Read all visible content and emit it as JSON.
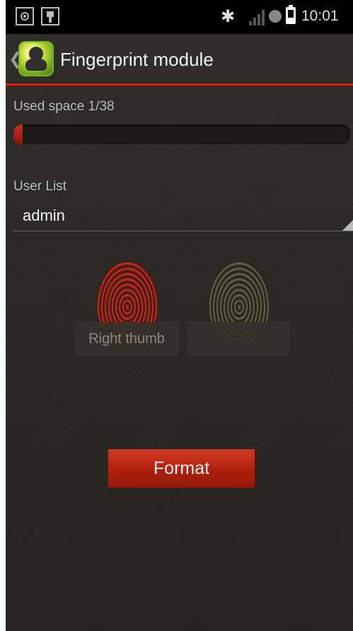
{
  "status_bar": {
    "time": "10:01",
    "icons": [
      "gps-icon",
      "usb-icon",
      "bluetooth-icon",
      "signal-icon",
      "sync-icon",
      "battery-icon"
    ]
  },
  "action_bar": {
    "back_glyph": "❮",
    "title": "Fingerprint module"
  },
  "storage": {
    "label": "Used space 1/38",
    "used": 1,
    "total": 38
  },
  "user_list": {
    "label": "User List",
    "selected": "admin"
  },
  "fingerprints": {
    "right_label": "Right thumb",
    "left_label": ""
  },
  "actions": {
    "format_label": "Format"
  },
  "colors": {
    "accent": "#c7261b",
    "background": "#2b2926"
  }
}
